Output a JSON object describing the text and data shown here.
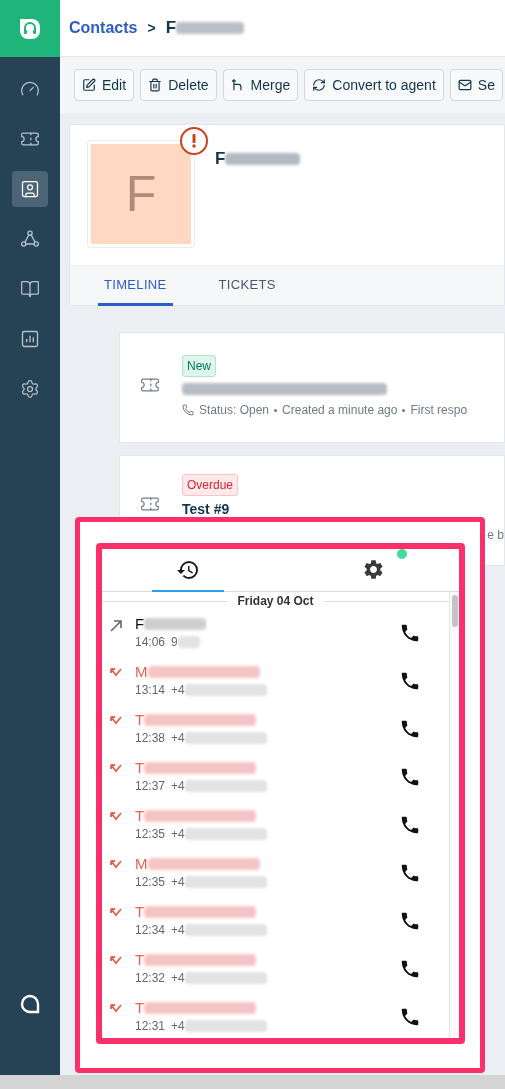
{
  "sidebar": {
    "items": [
      {
        "selected": false
      },
      {
        "selected": false
      },
      {
        "selected": true
      },
      {
        "selected": false
      },
      {
        "selected": false
      },
      {
        "selected": false
      },
      {
        "selected": false
      }
    ]
  },
  "breadcrumb": {
    "parent": "Contacts",
    "separator": ">",
    "current": "F"
  },
  "toolbar": [
    {
      "label": "Edit"
    },
    {
      "label": "Delete"
    },
    {
      "label": "Merge"
    },
    {
      "label": "Convert to agent"
    },
    {
      "label": "Se"
    }
  ],
  "contact": {
    "avatar_letter": "F",
    "alert": true,
    "name": "F"
  },
  "tabs": [
    {
      "label": "TIMELINE",
      "selected": true
    },
    {
      "label": "TICKETS",
      "selected": false
    }
  ],
  "timeline": [
    {
      "kind": "new",
      "badge": "New",
      "meta": [
        "Status: Open",
        "Created a minute ago",
        "First respo"
      ]
    },
    {
      "kind": "overdue",
      "badge": "Overdue",
      "title": "Test #9",
      "meta_fragment": "e b"
    }
  ],
  "phone_widget": {
    "tabs": [
      {
        "selected": true,
        "online": false
      },
      {
        "selected": false,
        "online": true
      }
    ],
    "date": "Friday 04 Oct",
    "calls": [
      {
        "kind": "outgoing",
        "name": "F",
        "time": "14:06",
        "number": "9"
      },
      {
        "kind": "missed",
        "name": "M",
        "time": "13:14",
        "number": "+4"
      },
      {
        "kind": "missed",
        "name": "T",
        "time": "12:38",
        "number": "+4"
      },
      {
        "kind": "missed",
        "name": "T",
        "time": "12:37",
        "number": "+4"
      },
      {
        "kind": "missed",
        "name": "T",
        "time": "12:35",
        "number": "+4"
      },
      {
        "kind": "missed",
        "name": "M",
        "time": "12:35",
        "number": "+4"
      },
      {
        "kind": "missed",
        "name": "T",
        "time": "12:34",
        "number": "+4"
      },
      {
        "kind": "missed",
        "name": "T",
        "time": "12:32",
        "number": "+4"
      },
      {
        "kind": "missed",
        "name": "T",
        "time": "12:31",
        "number": "+4"
      }
    ]
  }
}
